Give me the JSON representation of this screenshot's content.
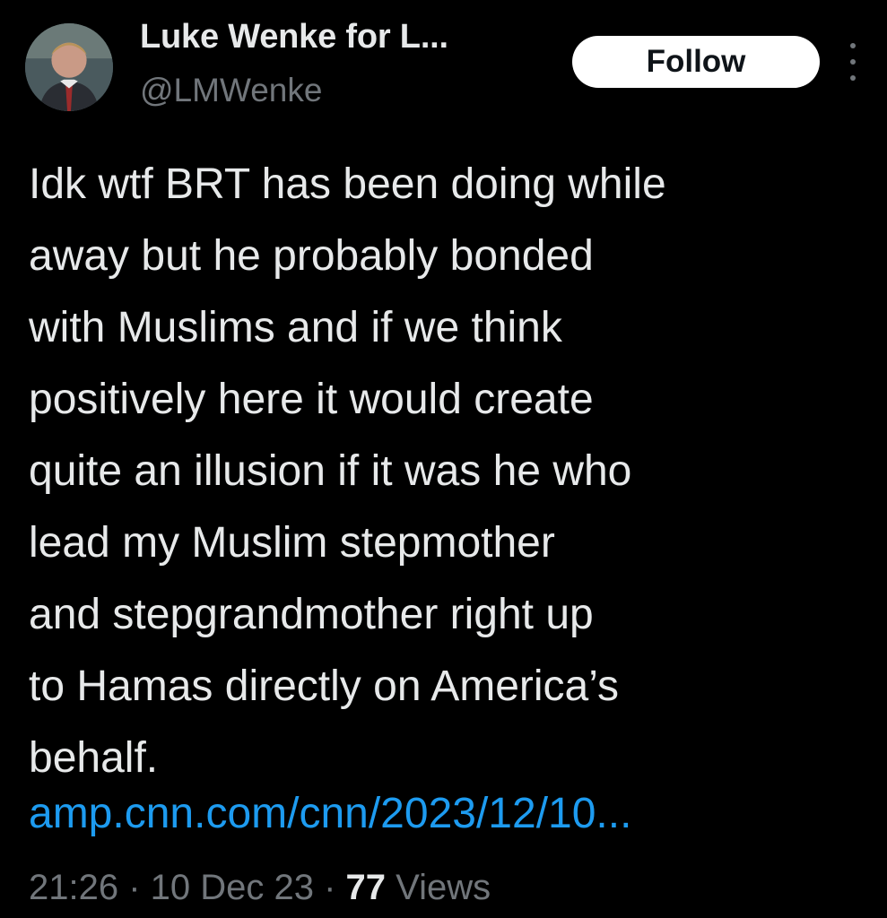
{
  "author": {
    "display_name": "Luke Wenke for L...",
    "handle": "@LMWenke",
    "avatar_icon": "profile-photo"
  },
  "actions": {
    "follow_label": "Follow",
    "more_icon": "more-vertical-icon"
  },
  "tweet": {
    "lines": [
      "Idk wtf BRT has been doing while",
      "away but he probably bonded",
      "with Muslims and if we think",
      "positively here it would create",
      "quite an illusion if it was he who",
      "lead my Muslim stepmother",
      "and stepgrandmother right up",
      "to Hamas directly on America’s",
      "behalf."
    ],
    "link": "amp.cnn.com/cnn/2023/12/10..."
  },
  "meta": {
    "time": "21:26",
    "sep1": " · ",
    "date": "10 Dec 23",
    "sep2": " · ",
    "views_count": "77",
    "views_label": " Views"
  },
  "colors": {
    "background": "#000000",
    "text": "#e7e9ea",
    "muted": "#71767b",
    "link": "#1d9bf0",
    "button_bg": "#ffffff"
  }
}
